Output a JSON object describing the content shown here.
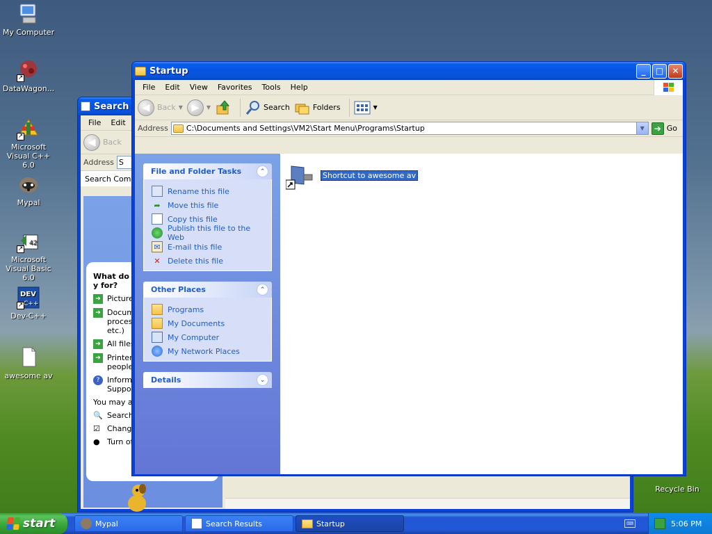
{
  "desktop": {
    "icons": [
      {
        "label": "My Computer",
        "icon": "my-computer-icon"
      },
      {
        "label": "DataWagon...",
        "icon": "datawagon-icon"
      },
      {
        "label": "Microsoft Visual C++ 6.0",
        "icon": "visual-cpp-icon"
      },
      {
        "label": "Mypal",
        "icon": "mypal-icon"
      },
      {
        "label": "Microsoft Visual Basic 6.0",
        "icon": "visual-basic-icon"
      },
      {
        "label": "Dev-C++",
        "icon": "dev-cpp-icon"
      },
      {
        "label": "awesome av",
        "icon": "file-icon"
      },
      {
        "label": "Recycle Bin",
        "icon": "recycle-bin-icon"
      }
    ]
  },
  "search_window": {
    "title": "Search R",
    "menu": [
      "File",
      "Edit"
    ],
    "back_label": "Back",
    "address_label": "Address",
    "address_value": "S",
    "search_panel_label": "Search Compa",
    "question": "What do y for?",
    "options": [
      "Picture",
      "Docume process etc.)",
      "All files",
      "Printers people",
      "Inform Suppor"
    ],
    "also_label": "You may als",
    "also_items": [
      "Search",
      "Change",
      "Turn of"
    ]
  },
  "window": {
    "title": "Startup",
    "menu": [
      "File",
      "Edit",
      "View",
      "Favorites",
      "Tools",
      "Help"
    ],
    "toolbar": {
      "back": "Back",
      "search": "Search",
      "folders": "Folders"
    },
    "address_label": "Address",
    "address_value": "C:\\Documents and Settings\\VM2\\Start Menu\\Programs\\Startup",
    "go": "Go",
    "file_tasks": {
      "title": "File and Folder Tasks",
      "items": [
        "Rename this file",
        "Move this file",
        "Copy this file",
        "Publish this file to the Web",
        "E-mail this file",
        "Delete this file"
      ]
    },
    "other_places": {
      "title": "Other Places",
      "items": [
        "Programs",
        "My Documents",
        "My Computer",
        "My Network Places"
      ]
    },
    "details": {
      "title": "Details"
    },
    "file": {
      "name": "Shortcut to awesome av"
    }
  },
  "taskbar": {
    "start": "start",
    "tasks": [
      "Mypal",
      "Search Results",
      "Startup"
    ],
    "clock": "5:06 PM"
  }
}
